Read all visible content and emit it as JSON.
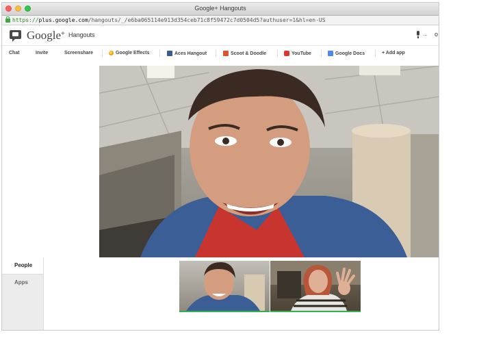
{
  "window": {
    "title": "Google+ Hangouts"
  },
  "address_bar": {
    "scheme": "https://",
    "host": "plus.google.com",
    "path": "/hangouts/_/e6ba065114e913d354ceb71c8f59472c7d0504d5?authuser=1&hl=en-US"
  },
  "header": {
    "logo_text": "Google",
    "logo_plus": "+",
    "product_name": "Hangouts",
    "dots": "...",
    "more": "o"
  },
  "toolbar": {
    "items": [
      {
        "label": "Chat",
        "icon": ""
      },
      {
        "label": "Invite",
        "icon": ""
      },
      {
        "label": "Screenshare",
        "icon": ""
      },
      {
        "label": "Google Effects",
        "icon": "effects-icon"
      },
      {
        "label": "Aces Hangout",
        "icon": "aces-icon"
      },
      {
        "label": "Scoot & Doodle",
        "icon": "scoot-icon"
      },
      {
        "label": "YouTube",
        "icon": "youtube-icon"
      },
      {
        "label": "Google Docs",
        "icon": "docs-icon"
      },
      {
        "label": "+ Add app",
        "icon": ""
      }
    ]
  },
  "sidebar": {
    "tabs": [
      {
        "label": "People",
        "active": true
      },
      {
        "label": "Apps",
        "active": false
      }
    ]
  },
  "colors": {
    "active_speaker": "#2fb24c",
    "url_secure": "#2a8a2a"
  }
}
